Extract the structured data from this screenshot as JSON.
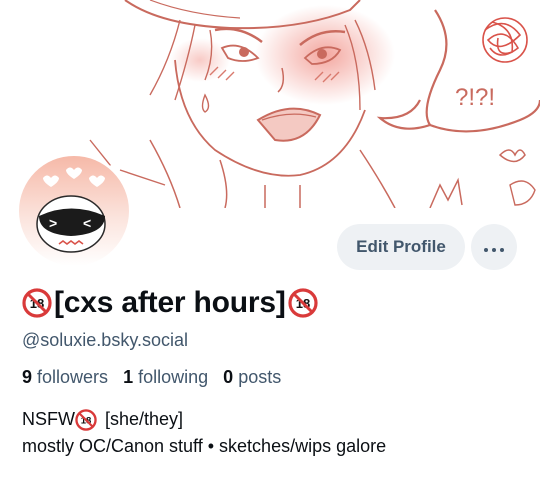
{
  "profile": {
    "display_name": "[cxs after hours]",
    "handle": "@soluxie.bsky.social",
    "stats": {
      "followers_count": "9",
      "followers_label": "followers",
      "following_count": "1",
      "following_label": "following",
      "posts_count": "0",
      "posts_label": "posts"
    },
    "bio": {
      "line1_prefix": "NSFW",
      "line1_suffix": "[she/they]",
      "line2": "mostly OC/Canon stuff • sketches/wips galore"
    },
    "banner_doodle_text": "?!?!",
    "badge_text": "18"
  },
  "actions": {
    "edit_profile_label": "Edit Profile"
  },
  "icons": {
    "name_badge": "no-under-18-icon",
    "more": "ellipsis-icon"
  },
  "colors": {
    "button_bg": "#eef1f4",
    "button_text": "#42576c",
    "secondary_text": "#42576c",
    "primary_text": "#0b0f14",
    "banner_line": "#c96a5e",
    "badge_red": "#d93a3a"
  }
}
